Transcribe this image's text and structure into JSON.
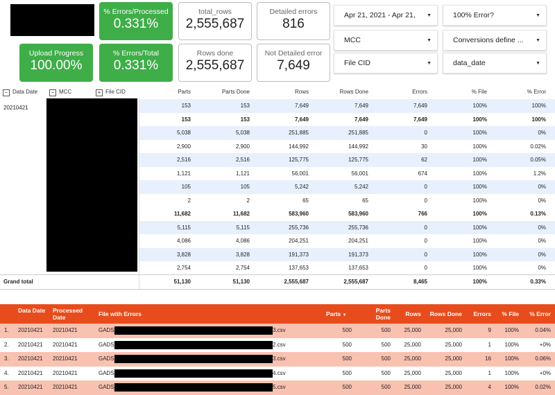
{
  "scorecards": {
    "errors_processed": {
      "label": "% Errors/Processed",
      "value": "0.331%"
    },
    "total_rows": {
      "label": "total_rows",
      "value": "2,555,687"
    },
    "detailed_errors": {
      "label": "Detailed errors",
      "value": "816"
    },
    "upload_progress": {
      "label": "Upload Progress",
      "value": "100.00%"
    },
    "errors_total": {
      "label": "% Errors/Total",
      "value": "0.331%"
    },
    "rows_done": {
      "label": "Rows done",
      "value": "2,555,687"
    },
    "not_detailed": {
      "label": "Not Detailed error",
      "value": "7,649"
    }
  },
  "filters": {
    "date_range": "Apr 21, 2021 - Apr 21,",
    "error_100": "100% Error?",
    "mcc": "MCC",
    "conversions": "Conversions define ...",
    "file_cid": "File CID",
    "data_date": "data_date"
  },
  "pivot": {
    "dims": {
      "data_date": "Data Date",
      "mcc": "MCC",
      "file_cid": "File CID"
    },
    "dim_ctrls": [
      "−",
      "−",
      "+"
    ],
    "columns": [
      "Parts",
      "Parts Done",
      "Rows",
      "Rows Done",
      "Errors",
      "% File",
      "% Error"
    ],
    "date_value": "20210421",
    "rows": [
      [
        "153",
        "153",
        "7,649",
        "7,649",
        "7,649",
        "100%",
        "100%"
      ],
      [
        "153",
        "153",
        "7,649",
        "7,649",
        "7,649",
        "100%",
        "100%"
      ],
      [
        "5,038",
        "5,038",
        "251,885",
        "251,885",
        "0",
        "100%",
        "0%"
      ],
      [
        "2,900",
        "2,900",
        "144,992",
        "144,992",
        "30",
        "100%",
        "0.02%"
      ],
      [
        "2,516",
        "2,516",
        "125,775",
        "125,775",
        "62",
        "100%",
        "0.05%"
      ],
      [
        "1,121",
        "1,121",
        "56,001",
        "56,001",
        "674",
        "100%",
        "1.2%"
      ],
      [
        "105",
        "105",
        "5,242",
        "5,242",
        "0",
        "100%",
        "0%"
      ],
      [
        "2",
        "2",
        "65",
        "65",
        "0",
        "100%",
        "0%"
      ],
      [
        "11,682",
        "11,682",
        "583,960",
        "583,960",
        "766",
        "100%",
        "0.13%"
      ],
      [
        "5,115",
        "5,115",
        "255,736",
        "255,736",
        "0",
        "100%",
        "0%"
      ],
      [
        "4,086",
        "4,086",
        "204,251",
        "204,251",
        "0",
        "100%",
        "0%"
      ],
      [
        "3,828",
        "3,828",
        "191,373",
        "191,373",
        "0",
        "100%",
        "0%"
      ],
      [
        "2,754",
        "2,754",
        "137,653",
        "137,653",
        "0",
        "100%",
        "0%"
      ]
    ],
    "grand_total": {
      "label": "Grand total",
      "values": [
        "51,130",
        "51,130",
        "2,555,687",
        "2,555,687",
        "8,465",
        "100%",
        "0.33%"
      ]
    }
  },
  "errors_table": {
    "headers": {
      "data_date": "Data Date",
      "processed_date": "Processed Date",
      "file": "File with Errors",
      "parts": "Parts",
      "parts_done": "Parts Done",
      "rows": "Rows",
      "rows_done": "Rows Done",
      "errors": "Errors",
      "pct_file": "% File",
      "pct_error": "% Error"
    },
    "sort_indicator": "▼",
    "rows": [
      {
        "idx": "1.",
        "data_date": "20210421",
        "processed_date": "20210421",
        "file_prefix": "GADS_",
        "file_suffix": "3.csv",
        "parts": "500",
        "parts_done": "500",
        "rows": "25,000",
        "rows_done": "25,000",
        "errors": "9",
        "pct_file": "100%",
        "pct_error": "0.04%"
      },
      {
        "idx": "2.",
        "data_date": "20210421",
        "processed_date": "20210421",
        "file_prefix": "GADS_",
        "file_suffix": "2.csv",
        "parts": "500",
        "parts_done": "500",
        "rows": "25,000",
        "rows_done": "25,000",
        "errors": "1",
        "pct_file": "100%",
        "pct_error": "+0%"
      },
      {
        "idx": "3.",
        "data_date": "20210421",
        "processed_date": "20210421",
        "file_prefix": "GADS_",
        "file_suffix": "3.csv",
        "parts": "500",
        "parts_done": "500",
        "rows": "25,000",
        "rows_done": "25,000",
        "errors": "16",
        "pct_file": "100%",
        "pct_error": "0.06%"
      },
      {
        "idx": "4.",
        "data_date": "20210421",
        "processed_date": "20210421",
        "file_prefix": "GADS_",
        "file_suffix": "4.csv",
        "parts": "500",
        "parts_done": "500",
        "rows": "25,000",
        "rows_done": "25,000",
        "errors": "1",
        "pct_file": "100%",
        "pct_error": "+0%"
      },
      {
        "idx": "5.",
        "data_date": "20210421",
        "processed_date": "20210421",
        "file_prefix": "GADS_",
        "file_suffix": "5.csv",
        "parts": "500",
        "parts_done": "500",
        "rows": "25,000",
        "rows_done": "25,000",
        "errors": "4",
        "pct_file": "100%",
        "pct_error": "0.02%"
      }
    ]
  }
}
